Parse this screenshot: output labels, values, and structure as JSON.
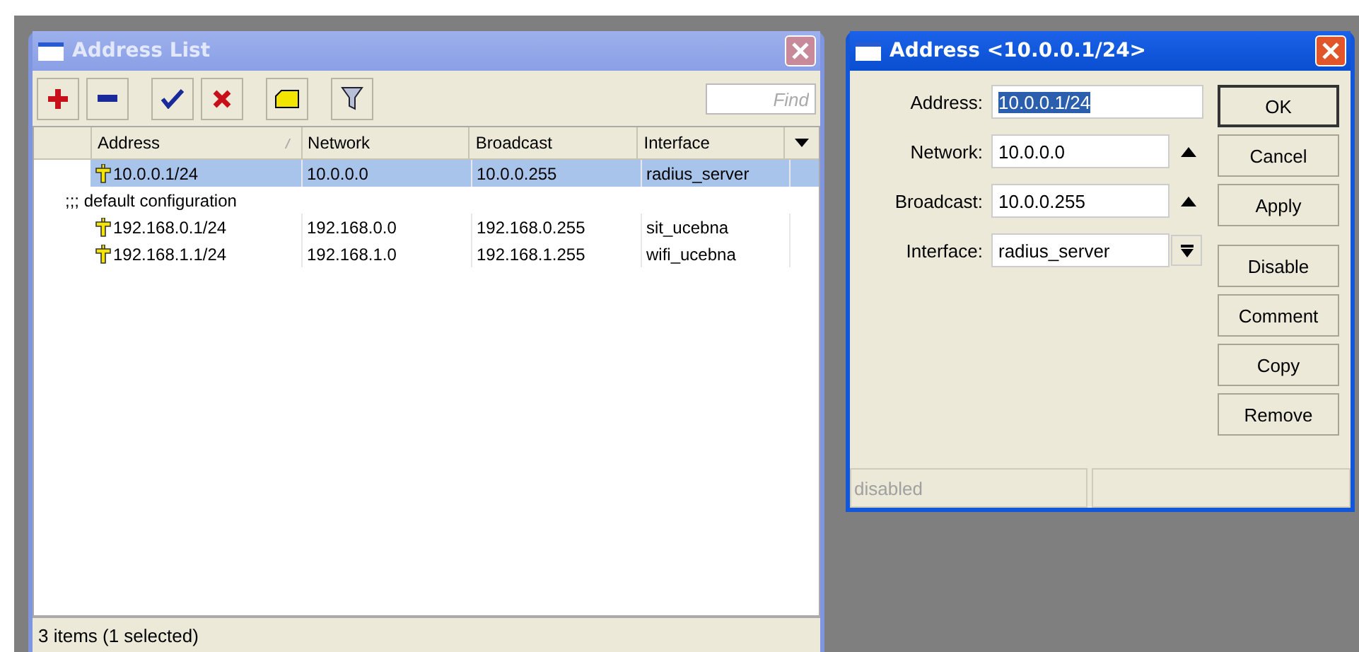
{
  "address_list": {
    "title": "Address List",
    "find": {
      "placeholder": "Find"
    },
    "columns": [
      {
        "label": "Address",
        "sorted": true
      },
      {
        "label": "Network",
        "sorted": false
      },
      {
        "label": "Broadcast",
        "sorted": false
      },
      {
        "label": "Interface",
        "sorted": false
      }
    ],
    "rows": [
      {
        "kind": "address",
        "selected": true,
        "cells": [
          "10.0.0.1/24",
          "10.0.0.0",
          "10.0.0.255",
          "radius_server"
        ]
      },
      {
        "kind": "comment",
        "text": ";;; default configuration"
      },
      {
        "kind": "address",
        "selected": false,
        "cells": [
          "192.168.0.1/24",
          "192.168.0.0",
          "192.168.0.255",
          "sit_ucebna"
        ]
      },
      {
        "kind": "address",
        "selected": false,
        "cells": [
          "192.168.1.1/24",
          "192.168.1.0",
          "192.168.1.255",
          "wifi_ucebna"
        ]
      }
    ],
    "status_bar": "3 items (1 selected)"
  },
  "address_dialog": {
    "title": "Address <10.0.0.1/24>",
    "fields": [
      {
        "label": "Address:",
        "value": "10.0.0.1/24",
        "kind": "plain",
        "value_selected": true
      },
      {
        "label": "Network:",
        "value": "10.0.0.0",
        "kind": "collapsible",
        "value_selected": false
      },
      {
        "label": "Broadcast:",
        "value": "10.0.0.255",
        "kind": "collapsible",
        "value_selected": false
      },
      {
        "label": "Interface:",
        "value": "radius_server",
        "kind": "dropdown",
        "value_selected": false
      }
    ],
    "button_groups": [
      [
        {
          "label": "OK",
          "default": true
        },
        {
          "label": "Cancel",
          "default": false
        },
        {
          "label": "Apply",
          "default": false
        }
      ],
      [
        {
          "label": "Disable",
          "default": false
        },
        {
          "label": "Comment",
          "default": false
        },
        {
          "label": "Copy",
          "default": false
        },
        {
          "label": "Remove",
          "default": false
        }
      ]
    ],
    "status_bar": "disabled"
  }
}
